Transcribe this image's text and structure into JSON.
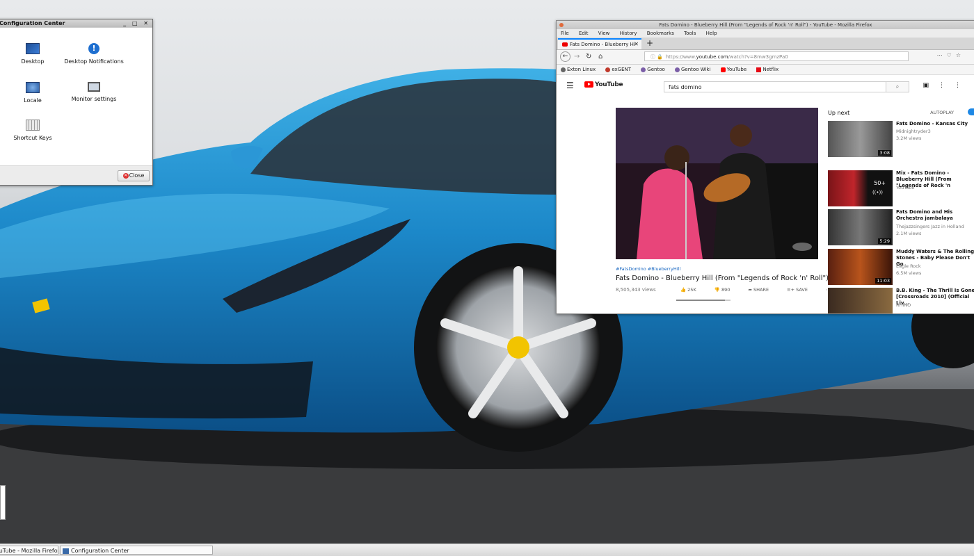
{
  "config_window": {
    "title": "Configuration Center",
    "items": [
      "Desktop",
      "Desktop Notifications",
      "Locale",
      "Monitor settings",
      "Shortcut Keys"
    ],
    "close_label": "Close",
    "controls": "_ □ ✕"
  },
  "firefox": {
    "window_title": "Fats Domino - Blueberry Hill (From \"Legends of Rock 'n' Roll\") - YouTube - Mozilla Firefox",
    "menu": [
      "File",
      "Edit",
      "View",
      "History",
      "Bookmarks",
      "Tools",
      "Help"
    ],
    "tab_title": "Fats Domino - Blueberry Hi",
    "url_prefix": "https://www.",
    "url_domain": "youtube.com",
    "url_path": "/watch?v=8mw3gmzPa0",
    "bookmarks": [
      {
        "label": "Exton Linux",
        "color": "#666666"
      },
      {
        "label": "exGENT",
        "color": "#c0392b"
      },
      {
        "label": "Gentoo",
        "color": "#7b5ea7"
      },
      {
        "label": "Gentoo Wiki",
        "color": "#7b5ea7"
      },
      {
        "label": "YouTube",
        "color": "#ff0000"
      },
      {
        "label": "Netflix",
        "color": "#e50914"
      }
    ]
  },
  "youtube": {
    "logo": "YouTube",
    "search_value": "fats domino",
    "video": {
      "tags": "#FatsDomino #BlueberryHill",
      "title": "Fats Domino - Blueberry Hill (From \"Legends of Rock 'n' Roll\")",
      "views": "8,505,343 views",
      "likes": "25K",
      "dislikes": "890",
      "share": "SHARE",
      "save": "SAVE"
    },
    "up_next": "Up next",
    "autoplay": "AUTOPLAY",
    "recommendations": [
      {
        "title": "Fats Domino - Kansas City",
        "channel": "Midnightryder3",
        "views": "3.2M views",
        "duration": "3:08"
      },
      {
        "title": "Mix - Fats Domino - Blueberry Hill (From \"Legends of Rock 'n",
        "channel": "YouTube",
        "views": "",
        "duration": "50+"
      },
      {
        "title": "Fats Domino and His Orchestra jambalaya",
        "channel": "Thejazzsingers Jazz in Holland",
        "views": "2.1M views",
        "duration": "5:29"
      },
      {
        "title": "Muddy Waters & The Rolling Stones - Baby Please Don't Go",
        "channel": "Eagle Rock",
        "views": "6.5M views",
        "duration": "11:03"
      },
      {
        "title": "B.B. King - The Thrill Is Gone [Crossroads 2010] (Official Liv...",
        "channel": "RHINO",
        "views": "",
        "duration": ""
      }
    ]
  },
  "taskbar": {
    "items": [
      "YouTube - Mozilla Firefox",
      "Configuration Center"
    ]
  }
}
